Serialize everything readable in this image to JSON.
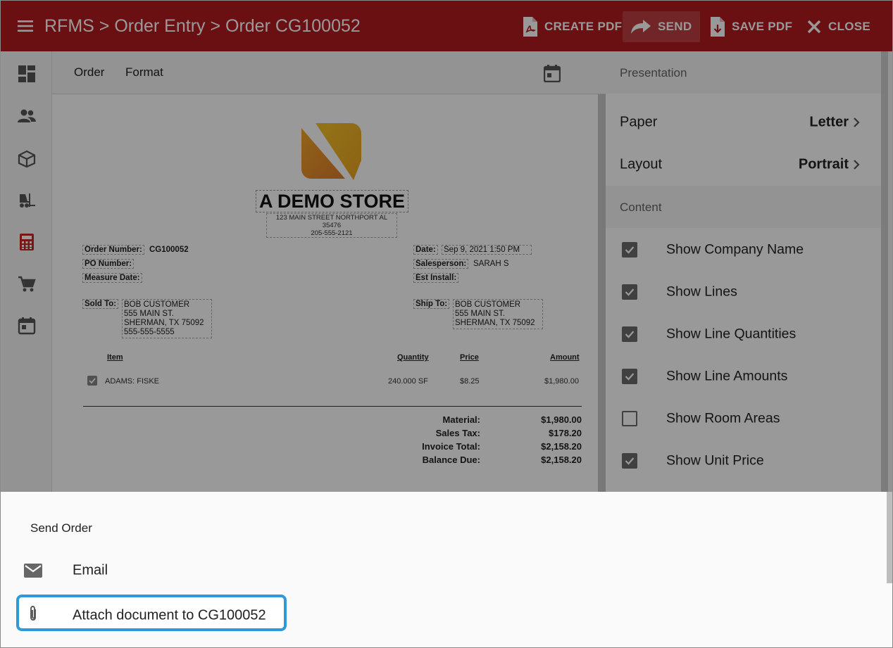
{
  "header": {
    "breadcrumb": "RFMS > Order Entry > Order CG100052",
    "actions": {
      "create_pdf": "CREATE PDF",
      "send": "SEND",
      "save_pdf": "SAVE PDF",
      "close": "CLOSE"
    },
    "bg_color": "#b31b1e"
  },
  "rail": {
    "icons": [
      "dashboard-icon",
      "people-icon",
      "box-icon",
      "forklift-icon",
      "calculator-icon",
      "cart-icon",
      "calendar-icon"
    ],
    "active": "calculator-icon",
    "active_color": "#c62828"
  },
  "preview": {
    "tabs": [
      "Order",
      "Format"
    ],
    "document": {
      "store_name": "A DEMO STORE",
      "store_address": "123 MAIN STREET NORTHPORT AL 35476",
      "store_phone": "205-555-2121",
      "order_number_label": "Order Number:",
      "order_number": "CG100052",
      "po_number_label": "PO Number:",
      "measure_date_label": "Measure Date:",
      "date_label": "Date:",
      "date": "Sep 9, 2021 1:50 PM",
      "salesperson_label": "Salesperson:",
      "salesperson": "SARAH S",
      "est_install_label": "Est Install:",
      "sold_to_label": "Sold To:",
      "sold_to": [
        "BOB CUSTOMER",
        "555 MAIN ST.",
        "SHERMAN, TX 75092",
        "555-555-5555"
      ],
      "ship_to_label": "Ship To:",
      "ship_to": [
        "BOB CUSTOMER",
        "555 MAIN ST.",
        "SHERMAN, TX 75092"
      ],
      "columns": {
        "item": "Item",
        "quantity": "Quantity",
        "price": "Price",
        "amount": "Amount"
      },
      "lines": [
        {
          "item": "ADAMS: FISKE",
          "quantity": "240.000 SF",
          "price": "$8.25",
          "amount": "$1,980.00"
        }
      ],
      "totals": [
        {
          "label": "Material:",
          "value": "$1,980.00"
        },
        {
          "label": "Sales Tax:",
          "value": "$178.20"
        },
        {
          "label": "Invoice Total:",
          "value": "$2,158.20"
        },
        {
          "label": "Balance Due:",
          "value": "$2,158.20"
        }
      ]
    }
  },
  "panel": {
    "presentation_header": "Presentation",
    "paper": {
      "label": "Paper",
      "value": "Letter"
    },
    "layout": {
      "label": "Layout",
      "value": "Portrait"
    },
    "content_header": "Content",
    "content_options": [
      {
        "label": "Show Company Name",
        "checked": true
      },
      {
        "label": "Show Lines",
        "checked": true
      },
      {
        "label": "Show Line Quantities",
        "checked": true
      },
      {
        "label": "Show Line Amounts",
        "checked": true
      },
      {
        "label": "Show Room Areas",
        "checked": false
      },
      {
        "label": "Show Unit Price",
        "checked": true
      }
    ]
  },
  "sheet": {
    "title": "Send Order",
    "items": [
      {
        "label": "Email",
        "icon": "mail-icon"
      },
      {
        "label": "Attach document to CG100052",
        "icon": "paperclip-icon",
        "highlighted": true
      }
    ],
    "highlight_color": "#2e9ad8"
  }
}
